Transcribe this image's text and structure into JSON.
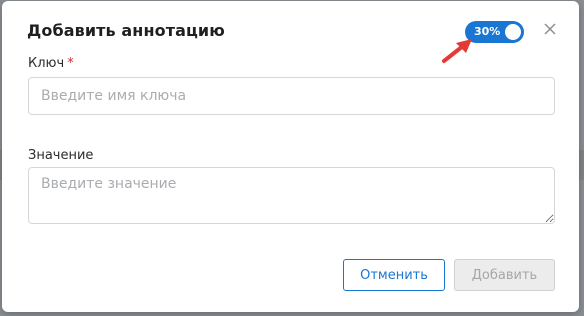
{
  "dialog": {
    "title": "Добавить аннотацию",
    "toggle": {
      "label": "30%",
      "on": true,
      "color": "#1976d2"
    },
    "close_icon": "close-icon",
    "pointer_arrow_color": "#e53935"
  },
  "form": {
    "key": {
      "label": "Ключ",
      "required_mark": "*",
      "value": "",
      "placeholder": "Введите имя ключа"
    },
    "value": {
      "label": "Значение",
      "value": "",
      "placeholder": "Введите значение"
    }
  },
  "actions": {
    "cancel_label": "Отменить",
    "add_label": "Добавить",
    "add_disabled": true
  }
}
